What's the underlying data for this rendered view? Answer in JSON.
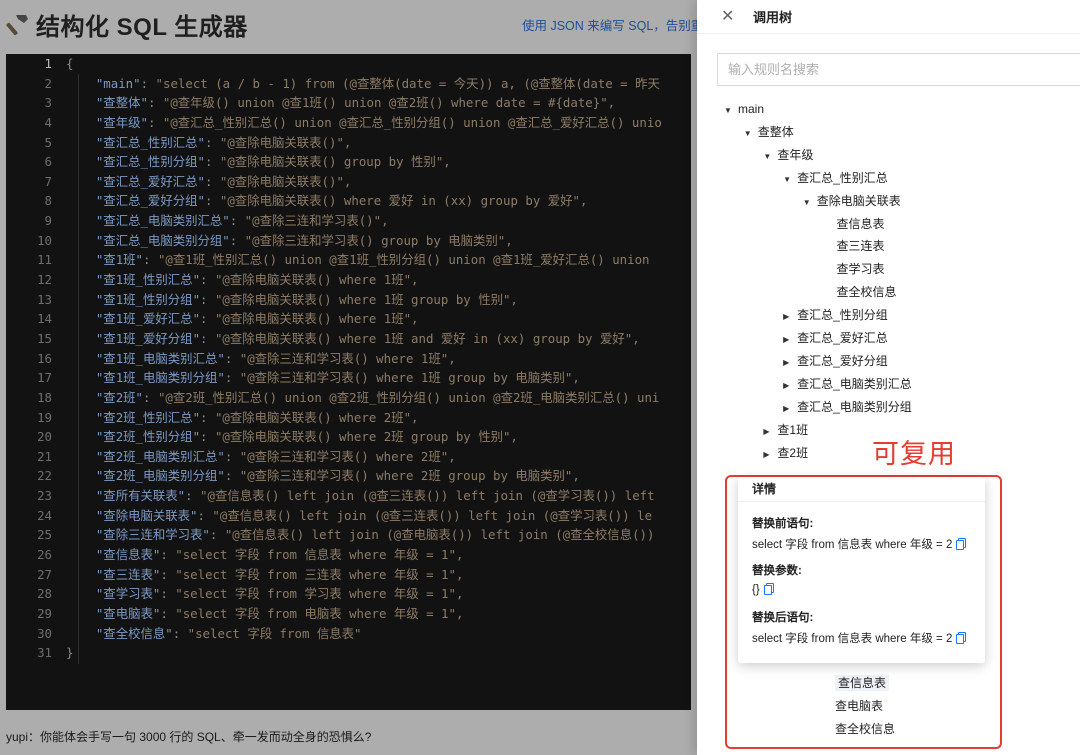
{
  "app": {
    "title": "结构化 SQL 生成器",
    "top_link": "使用 JSON 来编写 SQL，告别重复"
  },
  "editor": {
    "lines": [
      "{",
      "    \"main\": \"select (a / b - 1) from (@查整体(date = 今天)) a, (@查整体(date = 昨天",
      "    \"查整体\": \"@查年级() union @查1班() union @查2班() where date = #{date}\",",
      "    \"查年级\": \"@查汇总_性别汇总() union @查汇总_性别分组() union @查汇总_爱好汇总() unio",
      "    \"查汇总_性别汇总\": \"@查除电脑关联表()\",",
      "    \"查汇总_性别分组\": \"@查除电脑关联表() group by 性别\",",
      "    \"查汇总_爱好汇总\": \"@查除电脑关联表()\",",
      "    \"查汇总_爱好分组\": \"@查除电脑关联表() where 爱好 in (xx) group by 爱好\",",
      "    \"查汇总_电脑类别汇总\": \"@查除三连和学习表()\",",
      "    \"查汇总_电脑类别分组\": \"@查除三连和学习表() group by 电脑类别\",",
      "    \"查1班\": \"@查1班_性别汇总() union @查1班_性别分组() union @查1班_爱好汇总() union",
      "    \"查1班_性别汇总\": \"@查除电脑关联表() where 1班\",",
      "    \"查1班_性别分组\": \"@查除电脑关联表() where 1班 group by 性别\",",
      "    \"查1班_爱好汇总\": \"@查除电脑关联表() where 1班\",",
      "    \"查1班_爱好分组\": \"@查除电脑关联表() where 1班 and 爱好 in (xx) group by 爱好\",",
      "    \"查1班_电脑类别汇总\": \"@查除三连和学习表() where 1班\",",
      "    \"查1班_电脑类别分组\": \"@查除三连和学习表() where 1班 group by 电脑类别\",",
      "    \"查2班\": \"@查2班_性别汇总() union @查2班_性别分组() union @查2班_电脑类别汇总() uni",
      "    \"查2班_性别汇总\": \"@查除电脑关联表() where 2班\",",
      "    \"查2班_性别分组\": \"@查除电脑关联表() where 2班 group by 性别\",",
      "    \"查2班_电脑类别汇总\": \"@查除三连和学习表() where 2班\",",
      "    \"查2班_电脑类别分组\": \"@查除三连和学习表() where 2班 group by 电脑类别\",",
      "    \"查所有关联表\": \"@查信息表() left join (@查三连表()) left join (@查学习表()) left",
      "    \"查除电脑关联表\": \"@查信息表() left join (@查三连表()) left join (@查学习表()) le",
      "    \"查除三连和学习表\": \"@查信息表() left join (@查电脑表()) left join (@查全校信息())",
      "    \"查信息表\": \"select 字段 from 信息表 where 年级 = 1\",",
      "    \"查三连表\": \"select 字段 from 三连表 where 年级 = 1\",",
      "    \"查学习表\": \"select 字段 from 学习表 where 年级 = 1\",",
      "    \"查电脑表\": \"select 字段 from 电脑表 where 年级 = 1\",",
      "    \"查全校信息\": \"select 字段 from 信息表\"",
      "}"
    ],
    "active_line": 1
  },
  "caption": "yupi：你能体会手写一句 3000 行的 SQL、牵一发而动全身的恐惧么?",
  "drawer": {
    "title": "调用树",
    "search_placeholder": "输入规则名搜索",
    "tree": [
      {
        "label": "main",
        "depth": 0,
        "state": "expanded"
      },
      {
        "label": "查整体",
        "depth": 1,
        "state": "expanded"
      },
      {
        "label": "查年级",
        "depth": 2,
        "state": "expanded"
      },
      {
        "label": "查汇总_性别汇总",
        "depth": 3,
        "state": "expanded"
      },
      {
        "label": "查除电脑关联表",
        "depth": 4,
        "state": "expanded"
      },
      {
        "label": "查信息表",
        "depth": 5,
        "state": "leaf"
      },
      {
        "label": "查三连表",
        "depth": 5,
        "state": "leaf"
      },
      {
        "label": "查学习表",
        "depth": 5,
        "state": "leaf"
      },
      {
        "label": "查全校信息",
        "depth": 5,
        "state": "leaf"
      },
      {
        "label": "查汇总_性别分组",
        "depth": 3,
        "state": "collapsed"
      },
      {
        "label": "查汇总_爱好汇总",
        "depth": 3,
        "state": "collapsed"
      },
      {
        "label": "查汇总_爱好分组",
        "depth": 3,
        "state": "collapsed"
      },
      {
        "label": "查汇总_电脑类别汇总",
        "depth": 3,
        "state": "collapsed"
      },
      {
        "label": "查汇总_电脑类别分组",
        "depth": 3,
        "state": "collapsed"
      },
      {
        "label": "查1班",
        "depth": 2,
        "state": "collapsed"
      },
      {
        "label": "查2班",
        "depth": 2,
        "state": "collapsed"
      }
    ],
    "tree_bottom": [
      {
        "label": "查信息表",
        "selected": true
      },
      {
        "label": "查电脑表",
        "selected": false
      },
      {
        "label": "查全校信息",
        "selected": false
      }
    ]
  },
  "annotation": {
    "label": "可复用",
    "color": "#e63d2e"
  },
  "popup": {
    "title": "详情",
    "before_label": "替换前语句:",
    "before_value": "select 字段 from 信息表 where 年级 = 2",
    "params_label": "替换参数:",
    "params_value": "{}",
    "after_label": "替换后语句:",
    "after_value": "select 字段 from 信息表 where 年级 = 2"
  },
  "icons": {
    "title_icon": "hammer-icon",
    "close": "close-icon",
    "copy": "copy-icon",
    "tree_expanded": "caret-down-icon",
    "tree_collapsed": "caret-right-icon"
  },
  "colors": {
    "accent": "#1677ff",
    "annotation": "#e63d2e"
  }
}
